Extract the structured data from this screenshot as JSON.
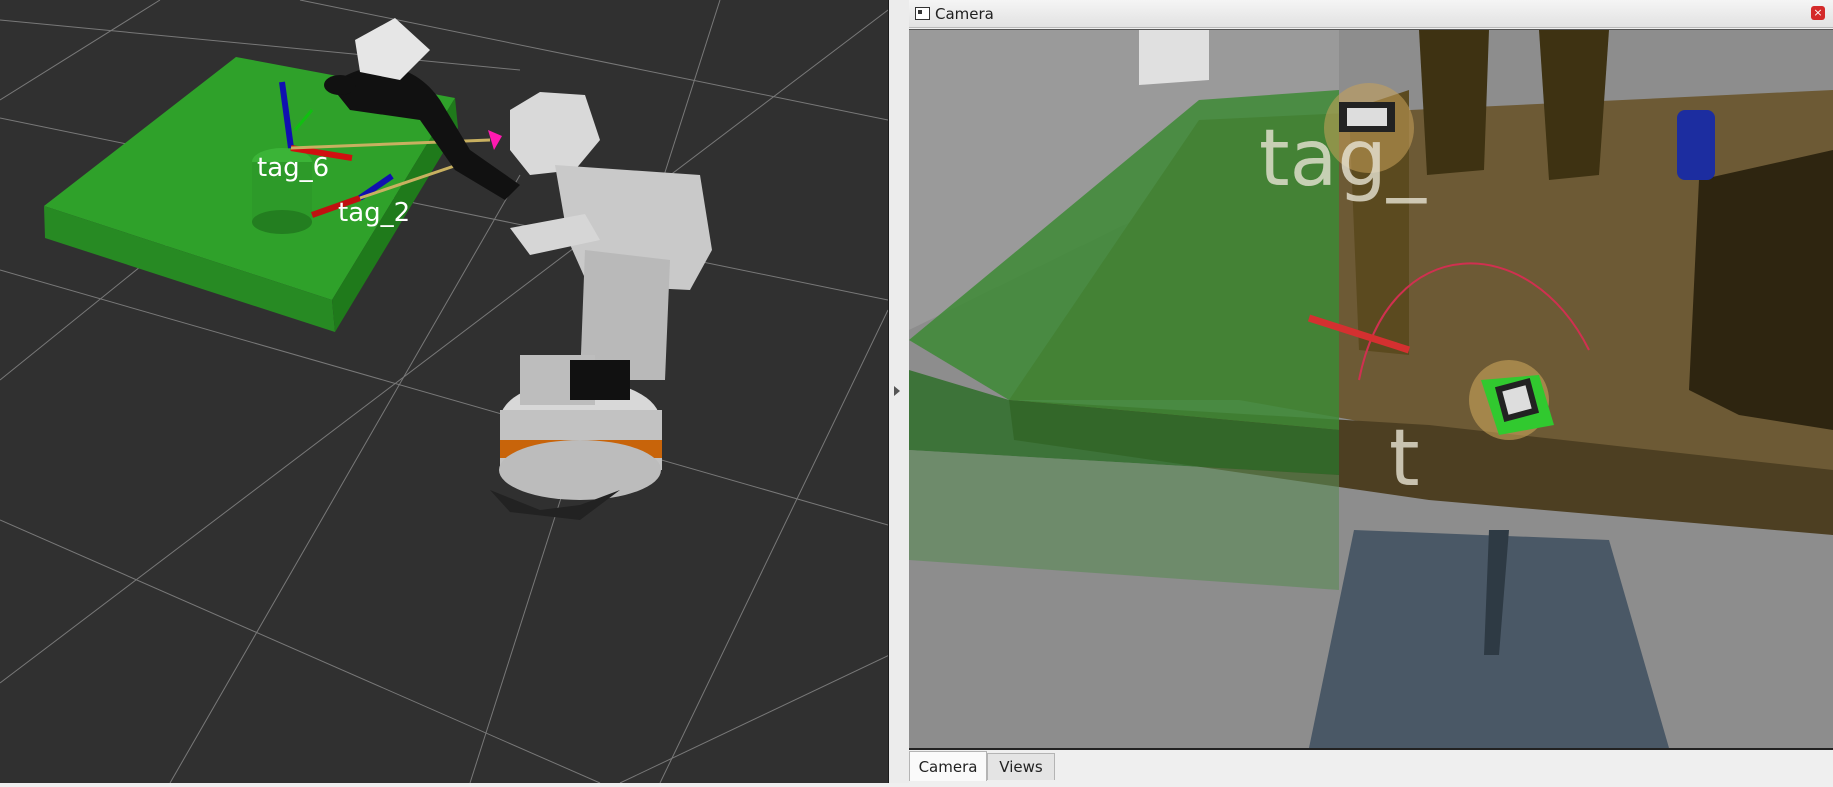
{
  "viewport": {
    "labels": {
      "tag_6": "tag_6",
      "tag_2": "tag_2"
    }
  },
  "camera_panel": {
    "title": "Camera",
    "close_glyph": "×",
    "overlay_label": "tag_",
    "overlay_fragment": "t"
  },
  "tabs": [
    {
      "label": "Camera",
      "active": true
    },
    {
      "label": "Views",
      "active": false
    }
  ],
  "colors": {
    "grid_bg": "#303030",
    "table_green": "#2fa12a",
    "robot_orange": "#c8640a",
    "tab_active": "#fafafa"
  },
  "icons": [
    "window-icon",
    "close-icon",
    "splitter-arrow-icon"
  ]
}
